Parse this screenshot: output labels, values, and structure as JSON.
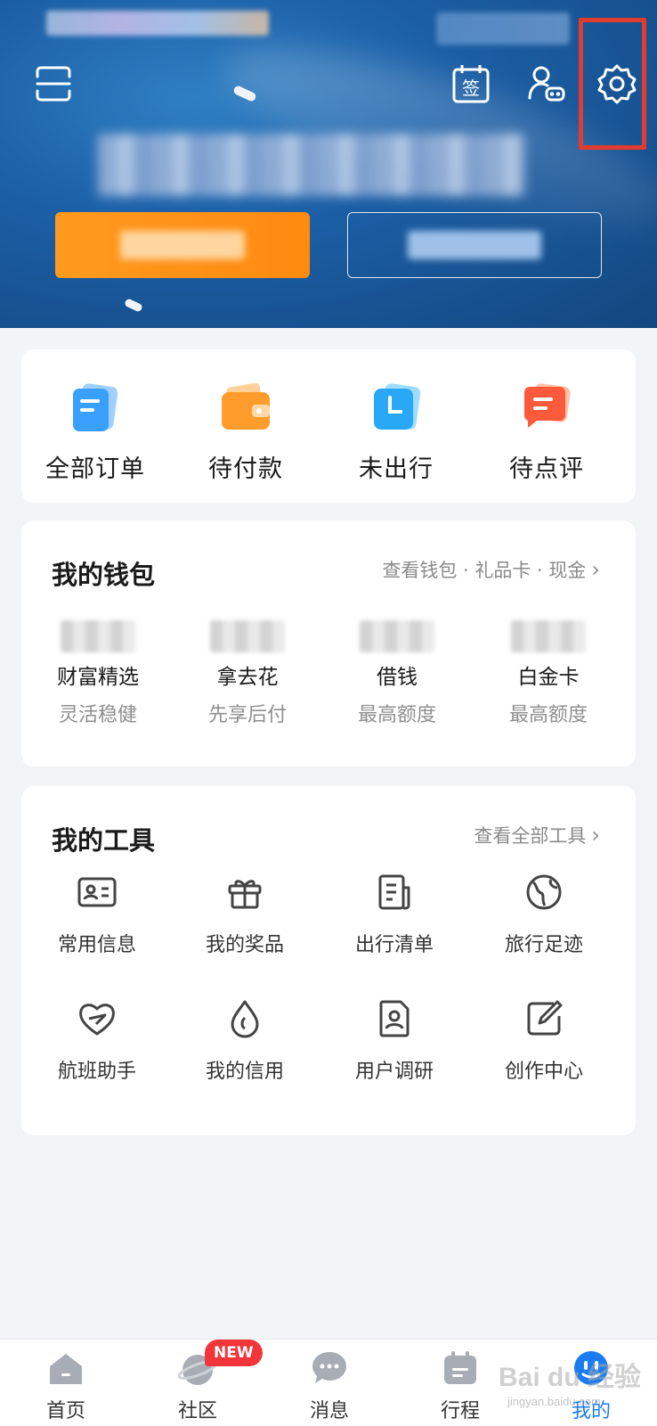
{
  "header": {
    "sign_icon_text": "签",
    "highlight_color": "#e23b2f",
    "button_orange_color": "#ff9a1f"
  },
  "orders": {
    "items": [
      {
        "label": "全部订单",
        "icon": "all-orders-icon"
      },
      {
        "label": "待付款",
        "icon": "wallet-pending-icon"
      },
      {
        "label": "未出行",
        "icon": "upcoming-trip-icon"
      },
      {
        "label": "待点评",
        "icon": "to-review-icon"
      }
    ]
  },
  "wallet": {
    "title": "我的钱包",
    "link": "查看钱包 · 礼品卡 · 现金",
    "items": [
      {
        "title": "财富精选",
        "sub": "灵活稳健"
      },
      {
        "title": "拿去花",
        "sub": "先享后付"
      },
      {
        "title": "借钱",
        "sub": "最高额度"
      },
      {
        "title": "白金卡",
        "sub": "最高额度"
      }
    ]
  },
  "tools": {
    "title": "我的工具",
    "link": "查看全部工具",
    "items": [
      {
        "label": "常用信息",
        "icon": "id-card-icon"
      },
      {
        "label": "我的奖品",
        "icon": "gift-icon"
      },
      {
        "label": "出行清单",
        "icon": "checklist-icon"
      },
      {
        "label": "旅行足迹",
        "icon": "globe-icon"
      },
      {
        "label": "航班助手",
        "icon": "flight-heart-icon"
      },
      {
        "label": "我的信用",
        "icon": "drop-icon"
      },
      {
        "label": "用户调研",
        "icon": "survey-icon"
      },
      {
        "label": "创作中心",
        "icon": "edit-icon"
      }
    ]
  },
  "tabbar": {
    "tabs": [
      {
        "label": "首页",
        "icon": "home-icon"
      },
      {
        "label": "社区",
        "icon": "community-icon"
      },
      {
        "label": "消息",
        "icon": "message-icon"
      },
      {
        "label": "行程",
        "icon": "trip-icon"
      },
      {
        "label": "我的",
        "icon": "profile-icon",
        "active": true
      }
    ],
    "badge": "NEW",
    "accent": "#1a7cf0"
  },
  "watermark": {
    "main": "Bai du 经验",
    "sub": "jingyan.baidu.com"
  }
}
